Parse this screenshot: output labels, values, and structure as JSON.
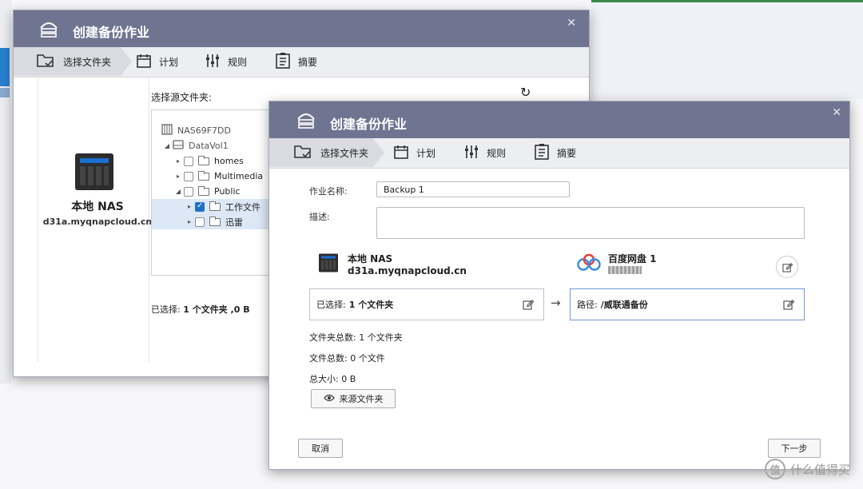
{
  "back_window": {
    "title": "创建备份作业",
    "tabs": [
      "选择文件夹",
      "计划",
      "规则",
      "摘要"
    ],
    "local_label": "本地 NAS",
    "host": "d31a.myqnapcloud.cn",
    "source_title": "选择源文件夹:",
    "tree": {
      "device": "NAS69F7DD",
      "volume": "DataVol1",
      "items": [
        "homes",
        "Multimedia",
        "Public",
        "工作文件",
        "迅雷"
      ]
    },
    "selected_summary": {
      "prefix": "已选择:",
      "value": "1 个文件夹 ,0 B"
    }
  },
  "front_window": {
    "title": "创建备份作业",
    "tabs": [
      "选择文件夹",
      "计划",
      "规则",
      "摘要"
    ],
    "job_name_label": "作业名称:",
    "job_name_value": "Backup 1",
    "desc_label": "描述:",
    "local_label": "本地 NAS",
    "host": "d31a.myqnapcloud.cn",
    "cloud_label": "百度网盘 1",
    "selected_prefix": "已选择:",
    "selected_value": "1 个文件夹",
    "path_prefix": "路径:",
    "path_value": "/威联通备份",
    "arrow": "→",
    "folder_total_label": "文件夹总数:",
    "folder_total_value": "1 个文件夹",
    "file_total_label": "文件总数:",
    "file_total_value": "0 个文件",
    "size_label": "总大小:",
    "size_value": "0 B",
    "source_button": "来源文件夹",
    "cancel_button": "取消",
    "next_button": "下一步"
  },
  "watermark": "什么值得买",
  "colors": {
    "titlebar": "#6f7591",
    "accent_blue": "#1f6fc5",
    "tab_bg": "#eceef1"
  }
}
